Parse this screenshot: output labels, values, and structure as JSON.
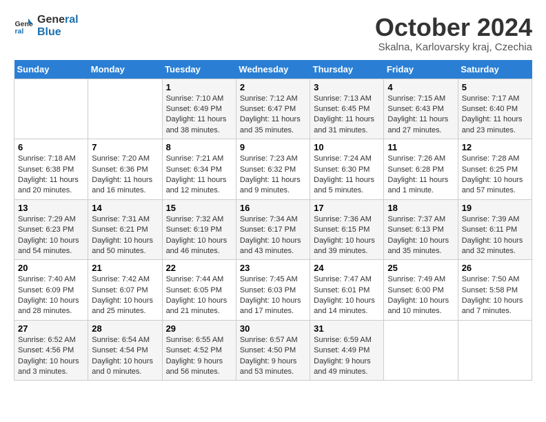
{
  "header": {
    "logo_line1": "General",
    "logo_line2": "Blue",
    "month_title": "October 2024",
    "location": "Skalna, Karlovarsky kraj, Czechia"
  },
  "weekdays": [
    "Sunday",
    "Monday",
    "Tuesday",
    "Wednesday",
    "Thursday",
    "Friday",
    "Saturday"
  ],
  "weeks": [
    [
      {
        "day": "",
        "info": ""
      },
      {
        "day": "",
        "info": ""
      },
      {
        "day": "1",
        "info": "Sunrise: 7:10 AM\nSunset: 6:49 PM\nDaylight: 11 hours and 38 minutes."
      },
      {
        "day": "2",
        "info": "Sunrise: 7:12 AM\nSunset: 6:47 PM\nDaylight: 11 hours and 35 minutes."
      },
      {
        "day": "3",
        "info": "Sunrise: 7:13 AM\nSunset: 6:45 PM\nDaylight: 11 hours and 31 minutes."
      },
      {
        "day": "4",
        "info": "Sunrise: 7:15 AM\nSunset: 6:43 PM\nDaylight: 11 hours and 27 minutes."
      },
      {
        "day": "5",
        "info": "Sunrise: 7:17 AM\nSunset: 6:40 PM\nDaylight: 11 hours and 23 minutes."
      }
    ],
    [
      {
        "day": "6",
        "info": "Sunrise: 7:18 AM\nSunset: 6:38 PM\nDaylight: 11 hours and 20 minutes."
      },
      {
        "day": "7",
        "info": "Sunrise: 7:20 AM\nSunset: 6:36 PM\nDaylight: 11 hours and 16 minutes."
      },
      {
        "day": "8",
        "info": "Sunrise: 7:21 AM\nSunset: 6:34 PM\nDaylight: 11 hours and 12 minutes."
      },
      {
        "day": "9",
        "info": "Sunrise: 7:23 AM\nSunset: 6:32 PM\nDaylight: 11 hours and 9 minutes."
      },
      {
        "day": "10",
        "info": "Sunrise: 7:24 AM\nSunset: 6:30 PM\nDaylight: 11 hours and 5 minutes."
      },
      {
        "day": "11",
        "info": "Sunrise: 7:26 AM\nSunset: 6:28 PM\nDaylight: 11 hours and 1 minute."
      },
      {
        "day": "12",
        "info": "Sunrise: 7:28 AM\nSunset: 6:25 PM\nDaylight: 10 hours and 57 minutes."
      }
    ],
    [
      {
        "day": "13",
        "info": "Sunrise: 7:29 AM\nSunset: 6:23 PM\nDaylight: 10 hours and 54 minutes."
      },
      {
        "day": "14",
        "info": "Sunrise: 7:31 AM\nSunset: 6:21 PM\nDaylight: 10 hours and 50 minutes."
      },
      {
        "day": "15",
        "info": "Sunrise: 7:32 AM\nSunset: 6:19 PM\nDaylight: 10 hours and 46 minutes."
      },
      {
        "day": "16",
        "info": "Sunrise: 7:34 AM\nSunset: 6:17 PM\nDaylight: 10 hours and 43 minutes."
      },
      {
        "day": "17",
        "info": "Sunrise: 7:36 AM\nSunset: 6:15 PM\nDaylight: 10 hours and 39 minutes."
      },
      {
        "day": "18",
        "info": "Sunrise: 7:37 AM\nSunset: 6:13 PM\nDaylight: 10 hours and 35 minutes."
      },
      {
        "day": "19",
        "info": "Sunrise: 7:39 AM\nSunset: 6:11 PM\nDaylight: 10 hours and 32 minutes."
      }
    ],
    [
      {
        "day": "20",
        "info": "Sunrise: 7:40 AM\nSunset: 6:09 PM\nDaylight: 10 hours and 28 minutes."
      },
      {
        "day": "21",
        "info": "Sunrise: 7:42 AM\nSunset: 6:07 PM\nDaylight: 10 hours and 25 minutes."
      },
      {
        "day": "22",
        "info": "Sunrise: 7:44 AM\nSunset: 6:05 PM\nDaylight: 10 hours and 21 minutes."
      },
      {
        "day": "23",
        "info": "Sunrise: 7:45 AM\nSunset: 6:03 PM\nDaylight: 10 hours and 17 minutes."
      },
      {
        "day": "24",
        "info": "Sunrise: 7:47 AM\nSunset: 6:01 PM\nDaylight: 10 hours and 14 minutes."
      },
      {
        "day": "25",
        "info": "Sunrise: 7:49 AM\nSunset: 6:00 PM\nDaylight: 10 hours and 10 minutes."
      },
      {
        "day": "26",
        "info": "Sunrise: 7:50 AM\nSunset: 5:58 PM\nDaylight: 10 hours and 7 minutes."
      }
    ],
    [
      {
        "day": "27",
        "info": "Sunrise: 6:52 AM\nSunset: 4:56 PM\nDaylight: 10 hours and 3 minutes."
      },
      {
        "day": "28",
        "info": "Sunrise: 6:54 AM\nSunset: 4:54 PM\nDaylight: 10 hours and 0 minutes."
      },
      {
        "day": "29",
        "info": "Sunrise: 6:55 AM\nSunset: 4:52 PM\nDaylight: 9 hours and 56 minutes."
      },
      {
        "day": "30",
        "info": "Sunrise: 6:57 AM\nSunset: 4:50 PM\nDaylight: 9 hours and 53 minutes."
      },
      {
        "day": "31",
        "info": "Sunrise: 6:59 AM\nSunset: 4:49 PM\nDaylight: 9 hours and 49 minutes."
      },
      {
        "day": "",
        "info": ""
      },
      {
        "day": "",
        "info": ""
      }
    ]
  ]
}
